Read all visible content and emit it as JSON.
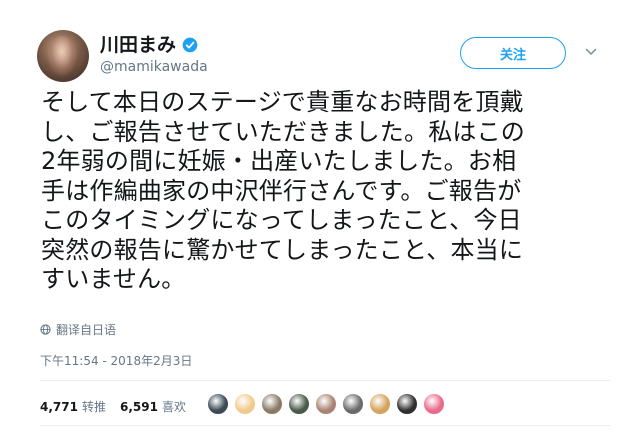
{
  "author": {
    "display_name": "川田まみ",
    "handle": "@mamikawada",
    "verified": true,
    "avatar": "profile-photo"
  },
  "follow_button": {
    "label": "关注"
  },
  "menu_icon": "chevron-down-icon",
  "tweet": {
    "lines": [
      "そして本日のステージで貴重なお時間を頂戴",
      "し、ご報告させていただきました。私はこの",
      "2年弱の間に妊娠・出産いたしました。お相",
      "手は作編曲家の中沢伴行さんです。ご報告が",
      "このタイミングになってしまったこと、今日",
      "突然の報告に驚かせてしまったこと、本当に",
      "すいません。"
    ]
  },
  "translate": {
    "label": "翻译自日语",
    "icon": "globe-icon"
  },
  "timestamp": "下午11:54 - 2018年2月3日",
  "stats": {
    "retweets_count": "4,771",
    "retweets_label": "转推",
    "likes_count": "6,591",
    "likes_label": "喜欢"
  },
  "likers": [
    {
      "color": "#3b4a55"
    },
    {
      "color": "#f3c98b"
    },
    {
      "color": "#8a7a66"
    },
    {
      "color": "#4b5a4a"
    },
    {
      "color": "#a98474"
    },
    {
      "color": "#6b6b6b"
    },
    {
      "color": "#d6a35c"
    },
    {
      "color": "#2f2f2f"
    },
    {
      "color": "#e86a8c"
    }
  ],
  "colors": {
    "accent": "#1da1f2",
    "text_primary": "#14171a",
    "text_secondary": "#657786",
    "divider": "#e6ecf0"
  }
}
